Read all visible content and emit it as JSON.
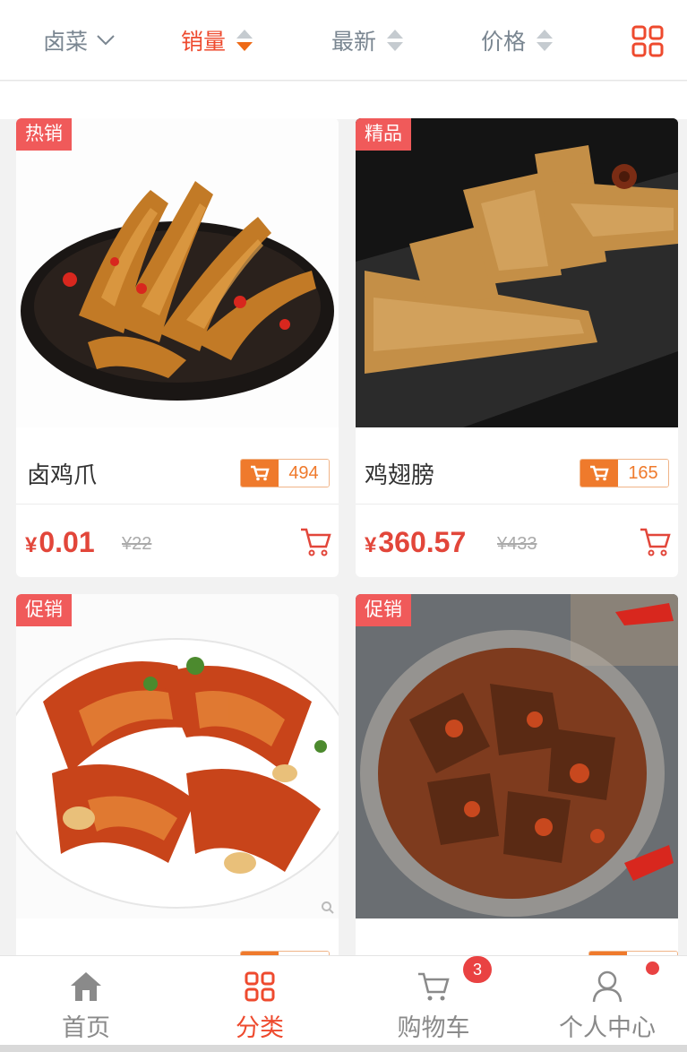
{
  "filters": {
    "category": "卤菜",
    "sales": "销量",
    "newest": "最新",
    "price": "价格",
    "accent": "#ee4a2e"
  },
  "products": [
    {
      "badge": "热销",
      "name": "卤鸡爪",
      "sold": "494",
      "currency": "¥",
      "price": "0.01",
      "old_price": "¥22"
    },
    {
      "badge": "精品",
      "name": "鸡翅膀",
      "sold": "165",
      "currency": "¥",
      "price": "360.57",
      "old_price": "¥433"
    },
    {
      "badge": "促销",
      "name": "",
      "sold": "",
      "currency": "¥",
      "price": "",
      "old_price": ""
    },
    {
      "badge": "促销",
      "name": "",
      "sold": "",
      "currency": "¥",
      "price": "",
      "old_price": ""
    }
  ],
  "nav": {
    "home": "首页",
    "category": "分类",
    "cart": "购物车",
    "profile": "个人中心",
    "cart_count": "3"
  }
}
